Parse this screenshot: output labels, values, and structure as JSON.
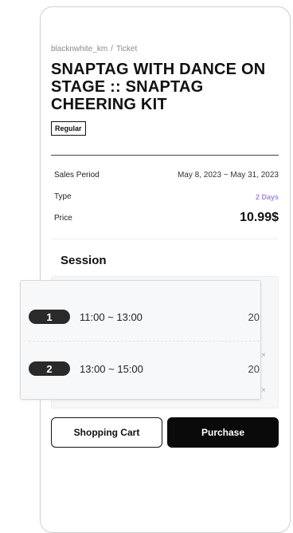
{
  "breadcrumb": {
    "seller": "blacknwhite_km",
    "separator": "/",
    "current": "Ticket"
  },
  "product": {
    "title": "SNAPTAG WITH DANCE ON STAGE :: SNAPTAG CHEERING KIT",
    "badge": "Regular"
  },
  "info": {
    "sales_period_label": "Sales Period",
    "sales_period_value": "May 8, 2023 ~ May 31, 2023",
    "type_label": "Type",
    "type_value": "2 Days",
    "price_label": "Price",
    "price_value": "10.99$"
  },
  "session": {
    "title": "Session",
    "options": [
      {
        "number": "1",
        "time": "11:00 ~ 13:00",
        "count": "20"
      },
      {
        "number": "2",
        "time": "13:00 ~ 15:00",
        "count": "20"
      }
    ],
    "remove_symbol": "×"
  },
  "actions": {
    "cart_label": "Shopping Cart",
    "purchase_label": "Purchase"
  }
}
